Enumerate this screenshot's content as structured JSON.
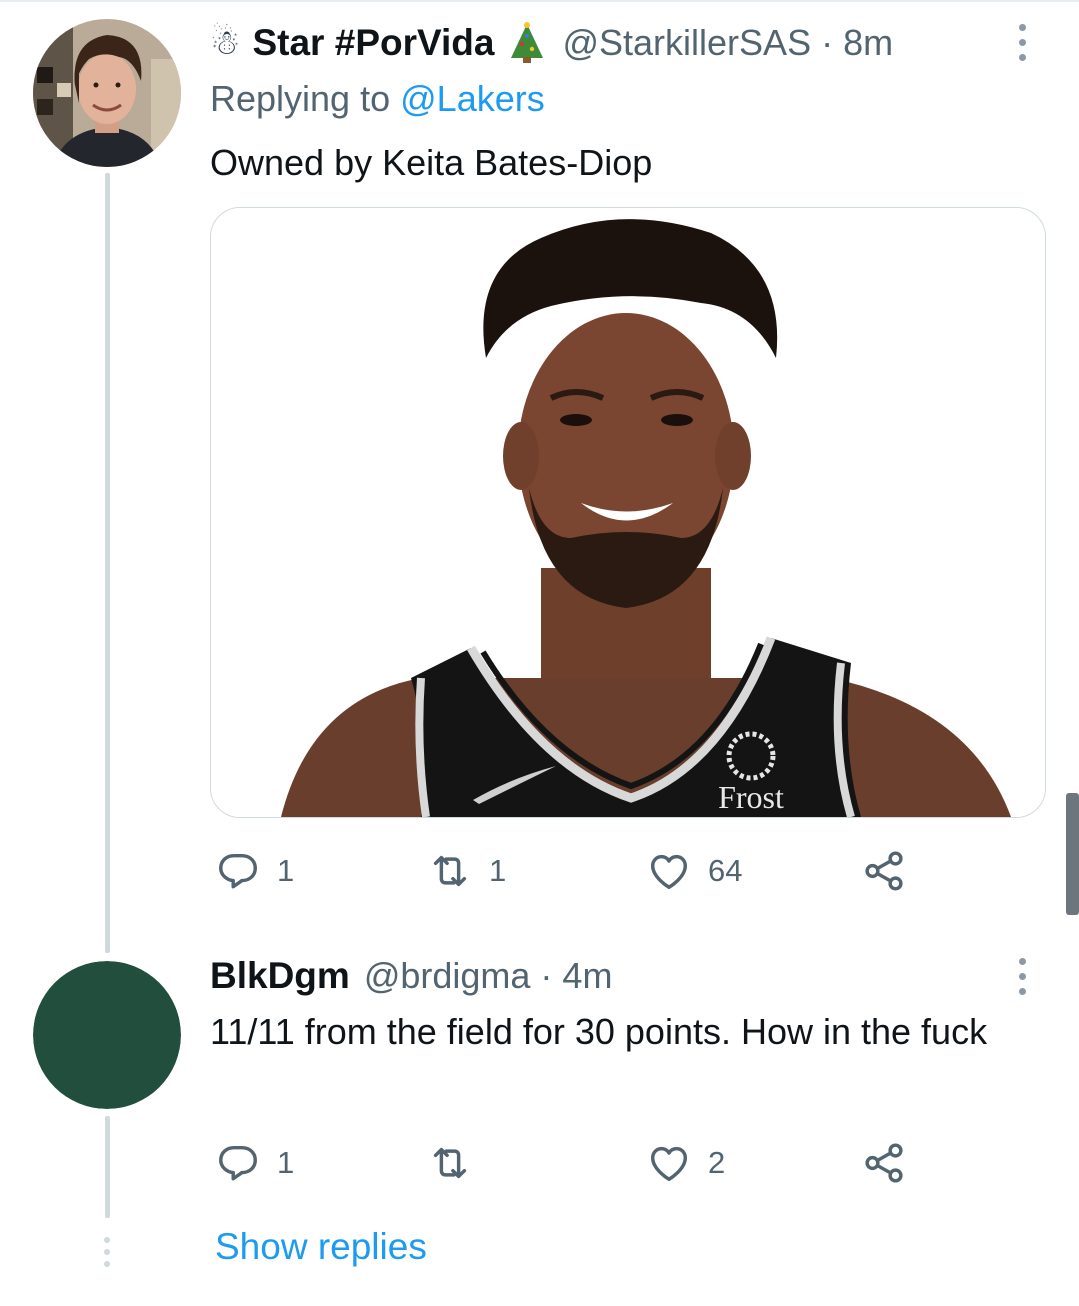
{
  "tweet1": {
    "display_name": "Star #PorVida",
    "name_prefix_emoji": "☃",
    "name_suffix_emoji": "🎄",
    "handle": "@StarkillerSAS",
    "separator": "·",
    "time": "8m",
    "replying_prefix": "Replying to",
    "replying_to": "@Lakers",
    "text": "Owned by Keita Bates-Diop",
    "media": {
      "jersey_logo_text": "Frost"
    },
    "actions": {
      "reply_count": "1",
      "retweet_count": "1",
      "like_count": "64"
    }
  },
  "tweet2": {
    "display_name": "BlkDgm",
    "handle": "@brdigma",
    "separator": "·",
    "time": "4m",
    "text": "11/11 from the field for 30 points. How in the fuck",
    "avatar_color": "#214e3d",
    "actions": {
      "reply_count": "1",
      "retweet_count": "",
      "like_count": "2"
    }
  },
  "show_replies_label": "Show replies",
  "colors": {
    "link": "#1d9bf0",
    "muted": "#536471",
    "thread_line": "#cfd9de"
  },
  "icons": [
    "reply-icon",
    "retweet-icon",
    "like-icon",
    "share-icon",
    "more-options-icon"
  ]
}
